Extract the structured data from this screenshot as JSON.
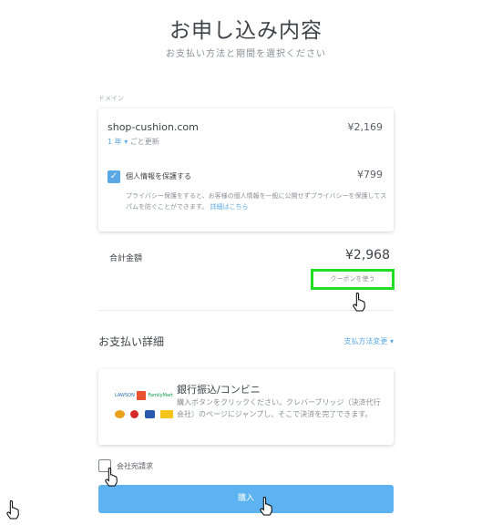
{
  "header": {
    "title": "お申し込み内容",
    "subtitle": "お支払い方法と期間を選択ください"
  },
  "domain_section": {
    "label": "ドメイン",
    "domain_name": "shop-cushion.com",
    "domain_price": "¥2,169",
    "term_value": "1 年",
    "term_caret": "▾",
    "term_suffix": "ごと更新",
    "privacy": {
      "checked": true,
      "label": "個人情報を保護する",
      "price": "¥799",
      "description": "プライバシー保護をすると、お客様の個人情報を一般に公開せずプライバシーを保護してスパムを防ぐことができます。",
      "link": "詳細はこちら"
    }
  },
  "total": {
    "label": "合計金額",
    "price": "¥2,968",
    "coupon_link": "クーポンを使う"
  },
  "payment": {
    "title": "お支払い詳細",
    "change_link": "支払方法変更 ▾",
    "method_title": "銀行振込/コンビニ",
    "method_description": "購入ボタンをクリックください。クレバーブリッジ（決済代行会社）のページにジャンプし、そこで決済を完了できます。",
    "logos": {
      "lawson": "LAWSON",
      "familymart": "FamilyMart"
    }
  },
  "corporate_invoice": {
    "checked": false,
    "label": "会社宛請求"
  },
  "buy_button": {
    "label": "購入"
  },
  "colors": {
    "accent": "#5aa9e6",
    "button": "#5cb3f0",
    "highlight": "#22dd22"
  }
}
